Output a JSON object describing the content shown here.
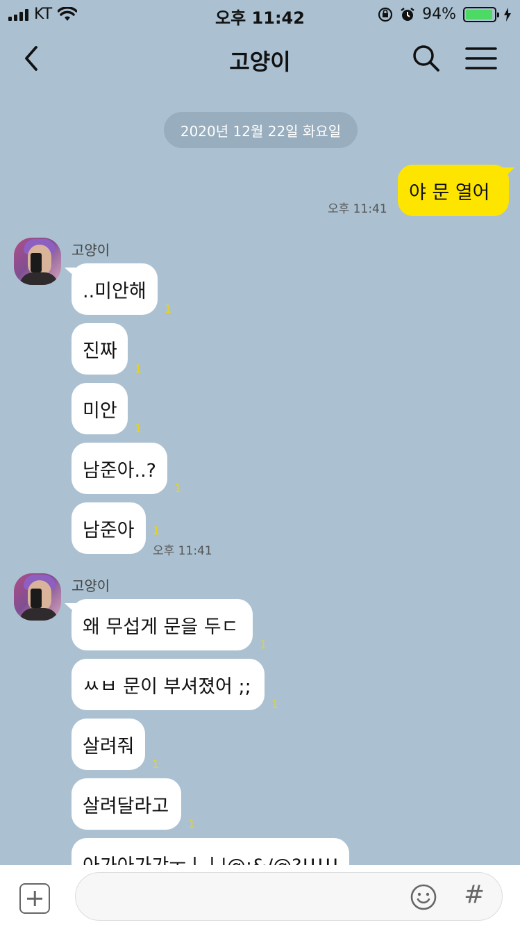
{
  "status_bar": {
    "carrier": "KT",
    "time": "오후 11:42",
    "battery": "94%"
  },
  "header": {
    "title": "고양이"
  },
  "chat": {
    "date_divider": "2020년 12월 22일 화요일",
    "outgoing": {
      "text": "야 문 열어",
      "time": "오후 11:41"
    },
    "group1": {
      "sender": "고양이",
      "messages": [
        "..미안해",
        "진짜",
        "미안",
        "남준아..?",
        "남준아"
      ],
      "unread": "1",
      "time": "오후 11:41"
    },
    "group2": {
      "sender": "고양이",
      "messages": [
        "왜 무섭게 문을 두ㄷ",
        "ㅆㅂ 문이 부셔졌어 ;;",
        "살려줘",
        "살려달라고",
        "아가아가갸ㅜㅣㅣ|@;&/@?!!!!!"
      ],
      "unread": "1"
    }
  },
  "input_bar": {
    "placeholder": "",
    "hash_label": "#"
  },
  "icons": {
    "back": "chevron-left-icon",
    "search": "search-icon",
    "menu": "hamburger-menu-icon",
    "plus": "plus-icon",
    "emoji": "smiley-icon"
  },
  "colors": {
    "background": "#abc1d1",
    "my_bubble": "#fee500",
    "their_bubble": "#ffffff",
    "unread_count": "#e8d31a"
  }
}
